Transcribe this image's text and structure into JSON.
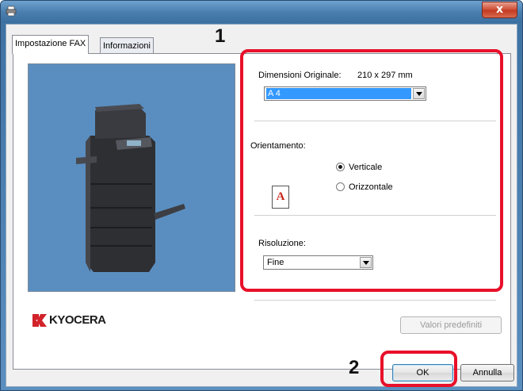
{
  "window": {
    "close_label": "x"
  },
  "tabs": [
    {
      "label": "Impostazione FAX",
      "active": true
    },
    {
      "label": "Informazioni",
      "active": false
    }
  ],
  "brand": {
    "logo_text": "KYOCERA"
  },
  "original_size": {
    "label": "Dimensioni Originale:",
    "dimensions": "210 x 297 mm",
    "selected": "A 4"
  },
  "orientation": {
    "label": "Orientamento:",
    "icon_glyph": "A",
    "options": [
      {
        "label": "Verticale",
        "checked": true
      },
      {
        "label": "Orizzontale",
        "checked": false
      }
    ]
  },
  "resolution": {
    "label": "Risoluzione:",
    "selected": "Fine"
  },
  "buttons": {
    "defaults": "Valori predefiniti",
    "ok": "OK",
    "cancel": "Annulla"
  },
  "callouts": {
    "settings_number": "1",
    "ok_number": "2"
  },
  "colors": {
    "callout": "#e8102a",
    "selection": "#3399ff",
    "preview_bg": "#5a8ec0"
  }
}
